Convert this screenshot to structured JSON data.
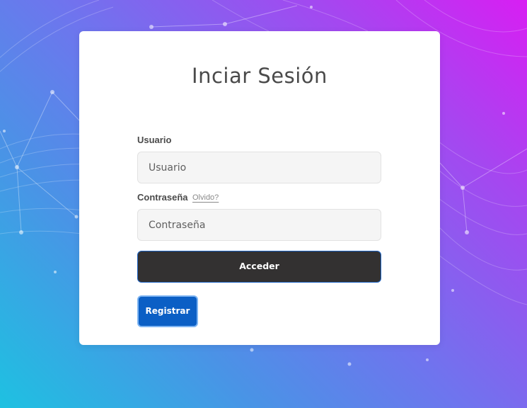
{
  "login": {
    "title": "Inciar Sesión",
    "username_label": "Usuario",
    "username_placeholder": "Usuario",
    "password_label": "Contraseña",
    "forgot_label": "Olvido?",
    "password_placeholder": "Contraseña",
    "submit_label": "Acceder",
    "register_label": "Registrar"
  },
  "colors": {
    "submit_bg": "#333131",
    "register_bg": "#0b5fc5",
    "gradient_top_right": "#d81ef3",
    "gradient_bottom_left": "#1ec1e1"
  }
}
